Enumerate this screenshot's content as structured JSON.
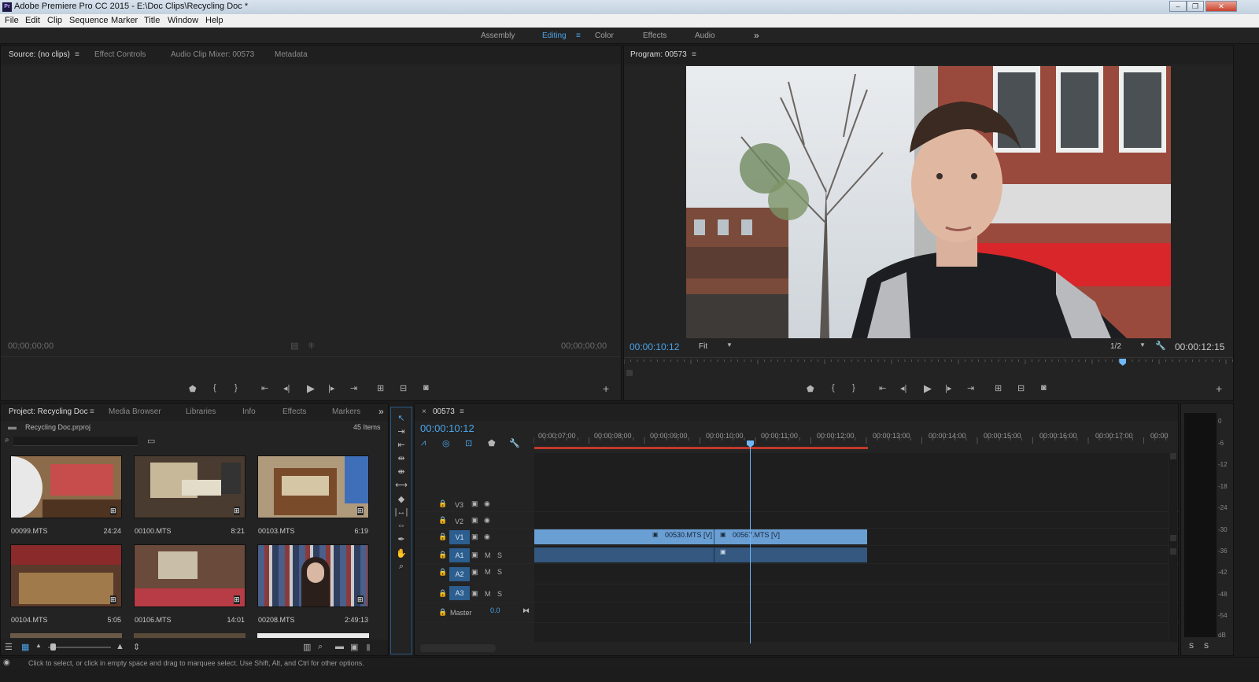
{
  "app": {
    "logo_text": "Pr",
    "window_title": "Adobe Premiere Pro CC 2015 - E:\\Doc Clips\\Recycling Doc *",
    "window_controls": [
      "–",
      "❐",
      "✕"
    ]
  },
  "menu": [
    "File",
    "Edit",
    "Clip",
    "Sequence",
    "Marker",
    "Title",
    "Window",
    "Help"
  ],
  "workspaces": {
    "items": [
      "Assembly",
      "Editing",
      "Color",
      "Effects",
      "Audio"
    ],
    "active": "Editing",
    "overflow": "»"
  },
  "source_panel": {
    "tabs": [
      "Source: (no clips)",
      "Effect Controls",
      "Audio Clip Mixer: 00573",
      "Metadata"
    ],
    "active_tab": "Source: (no clips)",
    "timecode_left": "00;00;00;00",
    "timecode_right": "00;00;00;00"
  },
  "program_panel": {
    "title": "Program: 00573",
    "timecode_current": "00:00:10:12",
    "zoom": "Fit",
    "resolution": "1/2",
    "timecode_duration": "00:00:12:15",
    "playhead_fraction": 0.82
  },
  "project_panel": {
    "tabs": [
      "Project: Recycling Doc",
      "Media Browser",
      "Libraries",
      "Info",
      "Effects",
      "Markers"
    ],
    "active_tab": "Project: Recycling Doc",
    "project_file": "Recycling Doc.prproj",
    "item_count": "45 Items",
    "search_placeholder": "",
    "clips": [
      {
        "name": "00099.MTS",
        "duration": "24:24"
      },
      {
        "name": "00100.MTS",
        "duration": "8:21"
      },
      {
        "name": "00103.MTS",
        "duration": "6:19"
      },
      {
        "name": "00104.MTS",
        "duration": "5:05"
      },
      {
        "name": "00106.MTS",
        "duration": "14:01"
      },
      {
        "name": "00208.MTS",
        "duration": "2:49:13"
      }
    ]
  },
  "timeline": {
    "sequence_name": "00573",
    "timecode": "00:00:10:12",
    "ruler": [
      "00:00:07:00",
      "00:00:08:00",
      "00:00:09:00",
      "00:00:10:00",
      "00:00:11:00",
      "00:00:12:00",
      "00:00:13:00",
      "00:00:14:00",
      "00:00:15:00",
      "00:00:16:00",
      "00:00:17:00",
      "00:00"
    ],
    "video_tracks": [
      "V3",
      "V2",
      "V1"
    ],
    "audio_tracks": [
      "A1",
      "A2",
      "A3"
    ],
    "master_label": "Master",
    "master_value": "0.0",
    "mute_label": "M",
    "solo_label": "S",
    "clips_v1": [
      "00530.MTS [V]",
      "00567.MTS [V]"
    ]
  },
  "audio_meter": {
    "scale": [
      "0",
      "-6",
      "-12",
      "-18",
      "-24",
      "-30",
      "-36",
      "-42",
      "-48",
      "-54",
      "dB"
    ],
    "solo_buttons": [
      "S",
      "S"
    ]
  },
  "status_bar": {
    "text": "Click to select, or click in empty space and drag to marquee select. Use Shift, Alt, and Ctrl for other options."
  },
  "colors": {
    "accent_blue": "#4aa3e8",
    "clip_video": "#6a9fd4",
    "clip_audio": "#34587f",
    "work_area_red": "#c0392b",
    "playhead": "#6fb7f5"
  }
}
